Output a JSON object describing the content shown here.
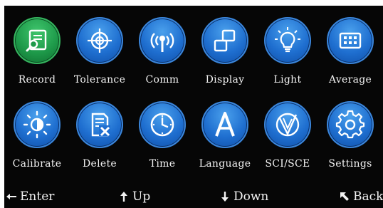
{
  "menu": {
    "items": [
      {
        "label": "Record",
        "icon": "record-icon"
      },
      {
        "label": "Tolerance",
        "icon": "crosshair-icon"
      },
      {
        "label": "Comm",
        "icon": "antenna-icon"
      },
      {
        "label": "Display",
        "icon": "windows-icon"
      },
      {
        "label": "Light",
        "icon": "lightbulb-icon"
      },
      {
        "label": "Average",
        "icon": "keypad-icon"
      },
      {
        "label": "Calibrate",
        "icon": "calibrate-icon"
      },
      {
        "label": "Delete",
        "icon": "delete-doc-icon"
      },
      {
        "label": "Time",
        "icon": "clock-icon"
      },
      {
        "label": "Language",
        "icon": "letter-a-icon"
      },
      {
        "label": "SCI/SCE",
        "icon": "sci-sce-icon"
      },
      {
        "label": "Settings",
        "icon": "gear-icon"
      }
    ],
    "selected_index": 0
  },
  "footer": {
    "enter": "Enter",
    "up": "Up",
    "down": "Down",
    "back": "Back"
  },
  "colors": {
    "background": "#060606",
    "icon_blue": "#1f6fd0",
    "icon_selected_green": "#1e9a4a",
    "text": "#f2f2f2"
  }
}
